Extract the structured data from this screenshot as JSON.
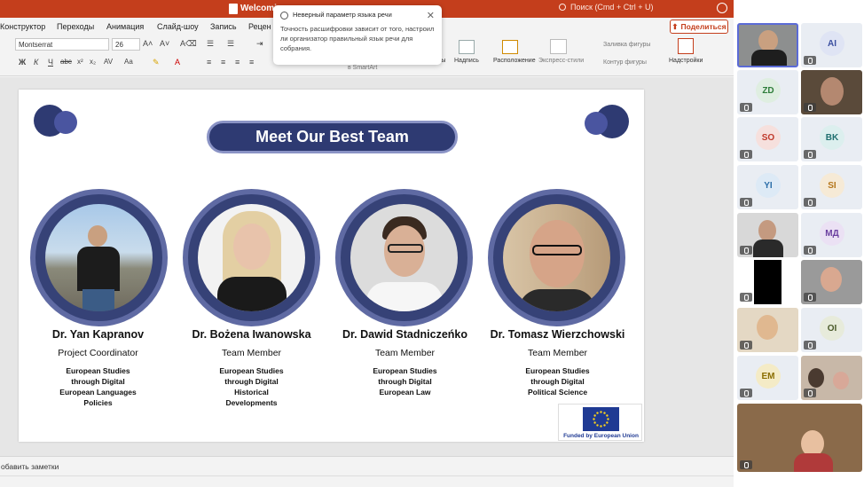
{
  "app": {
    "doc_title": "Welcomin",
    "search_placeholder": "Поиск (Cmd + Ctrl + U)",
    "share_label": "Поделиться"
  },
  "menu": [
    "Конструктор",
    "Переходы",
    "Анимация",
    "Слайд-шоу",
    "Запись",
    "Рецен"
  ],
  "ribbon": {
    "font_name": "Montserrat",
    "font_size": "26",
    "format_glyphs": [
      "Ж",
      "К",
      "Ч",
      "abc",
      "x²",
      "x₂",
      "AV",
      "Aa"
    ],
    "shapes_label": "уры",
    "textbox_label": "Надпись",
    "arrange_label": "Расположение",
    "express_styles_label": "Экспресс-стили",
    "shape_fill_label": "Заливка фигуры",
    "shape_outline_label": "Контур фигуры",
    "addins_label": "Надстройки",
    "smartart_label": "в SmartArt"
  },
  "toast": {
    "title": "Неверный параметр языка речи",
    "body": "Точность расшифровки зависит от того, настроил ли организатор правильный язык речи для собрания.",
    "close_glyph": "✕"
  },
  "slide": {
    "title": "Meet Our Best Team",
    "members": [
      {
        "name": "Dr. Yan Kapranov",
        "role": "Project Coordinator",
        "area": "European Studies\nthrough Digital\nEuropean Languages\nPolicies"
      },
      {
        "name": "Dr. Bożena Iwanowska",
        "role": "Team Member",
        "area": "European Studies\nthrough Digital\nHistorical\nDevelopments"
      },
      {
        "name": "Dr. Dawid Stadniczeńko",
        "role": "Team Member",
        "area": "European Studies\nthrough Digital\nEuropean Law"
      },
      {
        "name": "Dr. Tomasz Wierzchowski",
        "role": "Team Member",
        "area": "European Studies\nthrough Digital\nPolitical Science"
      }
    ],
    "funding": "Funded by European Union"
  },
  "notes": {
    "placeholder": "обавить заметки"
  },
  "participants": [
    {
      "initials": "",
      "video": true
    },
    {
      "initials": "AI",
      "video": false,
      "color": "#3b4fa0"
    },
    {
      "initials": "ZD",
      "video": false,
      "color": "#2e7d3a"
    },
    {
      "initials": "",
      "video": true
    },
    {
      "initials": "SO",
      "video": false,
      "color": "#c0392b"
    },
    {
      "initials": "BK",
      "video": false,
      "color": "#1f6f6f"
    },
    {
      "initials": "YI",
      "video": false,
      "color": "#2a6da8"
    },
    {
      "initials": "SI",
      "video": false,
      "color": "#b5761b"
    },
    {
      "initials": "",
      "video": true
    },
    {
      "initials": "МД",
      "video": false,
      "color": "#6b3fa0"
    },
    {
      "initials": "",
      "video": true
    },
    {
      "initials": "",
      "video": true
    },
    {
      "initials": "",
      "video": true
    },
    {
      "initials": "OI",
      "video": false,
      "color": "#4a5a2a"
    },
    {
      "initials": "EM",
      "video": false,
      "color": "#8a6d00"
    },
    {
      "initials": "",
      "video": true
    },
    {
      "initials": "",
      "video": true
    }
  ]
}
